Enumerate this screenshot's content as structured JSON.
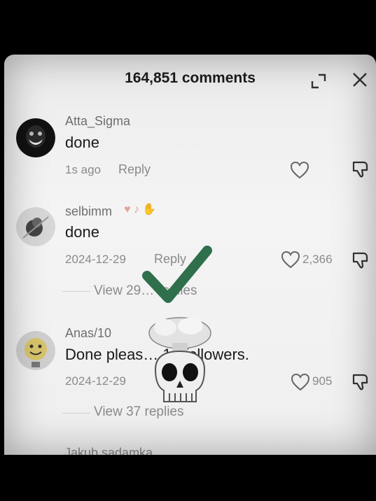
{
  "header": {
    "title": "164,851 comments"
  },
  "comments": [
    {
      "username": "Atta_Sigma",
      "text": "done",
      "time": "1s ago",
      "reply": "Reply",
      "likes": ""
    },
    {
      "username": "selbimm",
      "text": "done",
      "time": "2024-12-29",
      "reply": "Reply",
      "likes": "2,366",
      "view_replies": "View 29… replies"
    },
    {
      "username": "Anas/10",
      "text": "Done pleas… 16 followers.",
      "time": "2024-12-29",
      "reply": "",
      "likes": "905",
      "view_replies": "View 37 replies"
    }
  ],
  "partial_next_username": "Jakub sadamka",
  "overlay": {
    "check_color": "#2f6f4c"
  },
  "colors": {
    "panel_bg": "#efefef",
    "outer_bg": "#000000"
  }
}
